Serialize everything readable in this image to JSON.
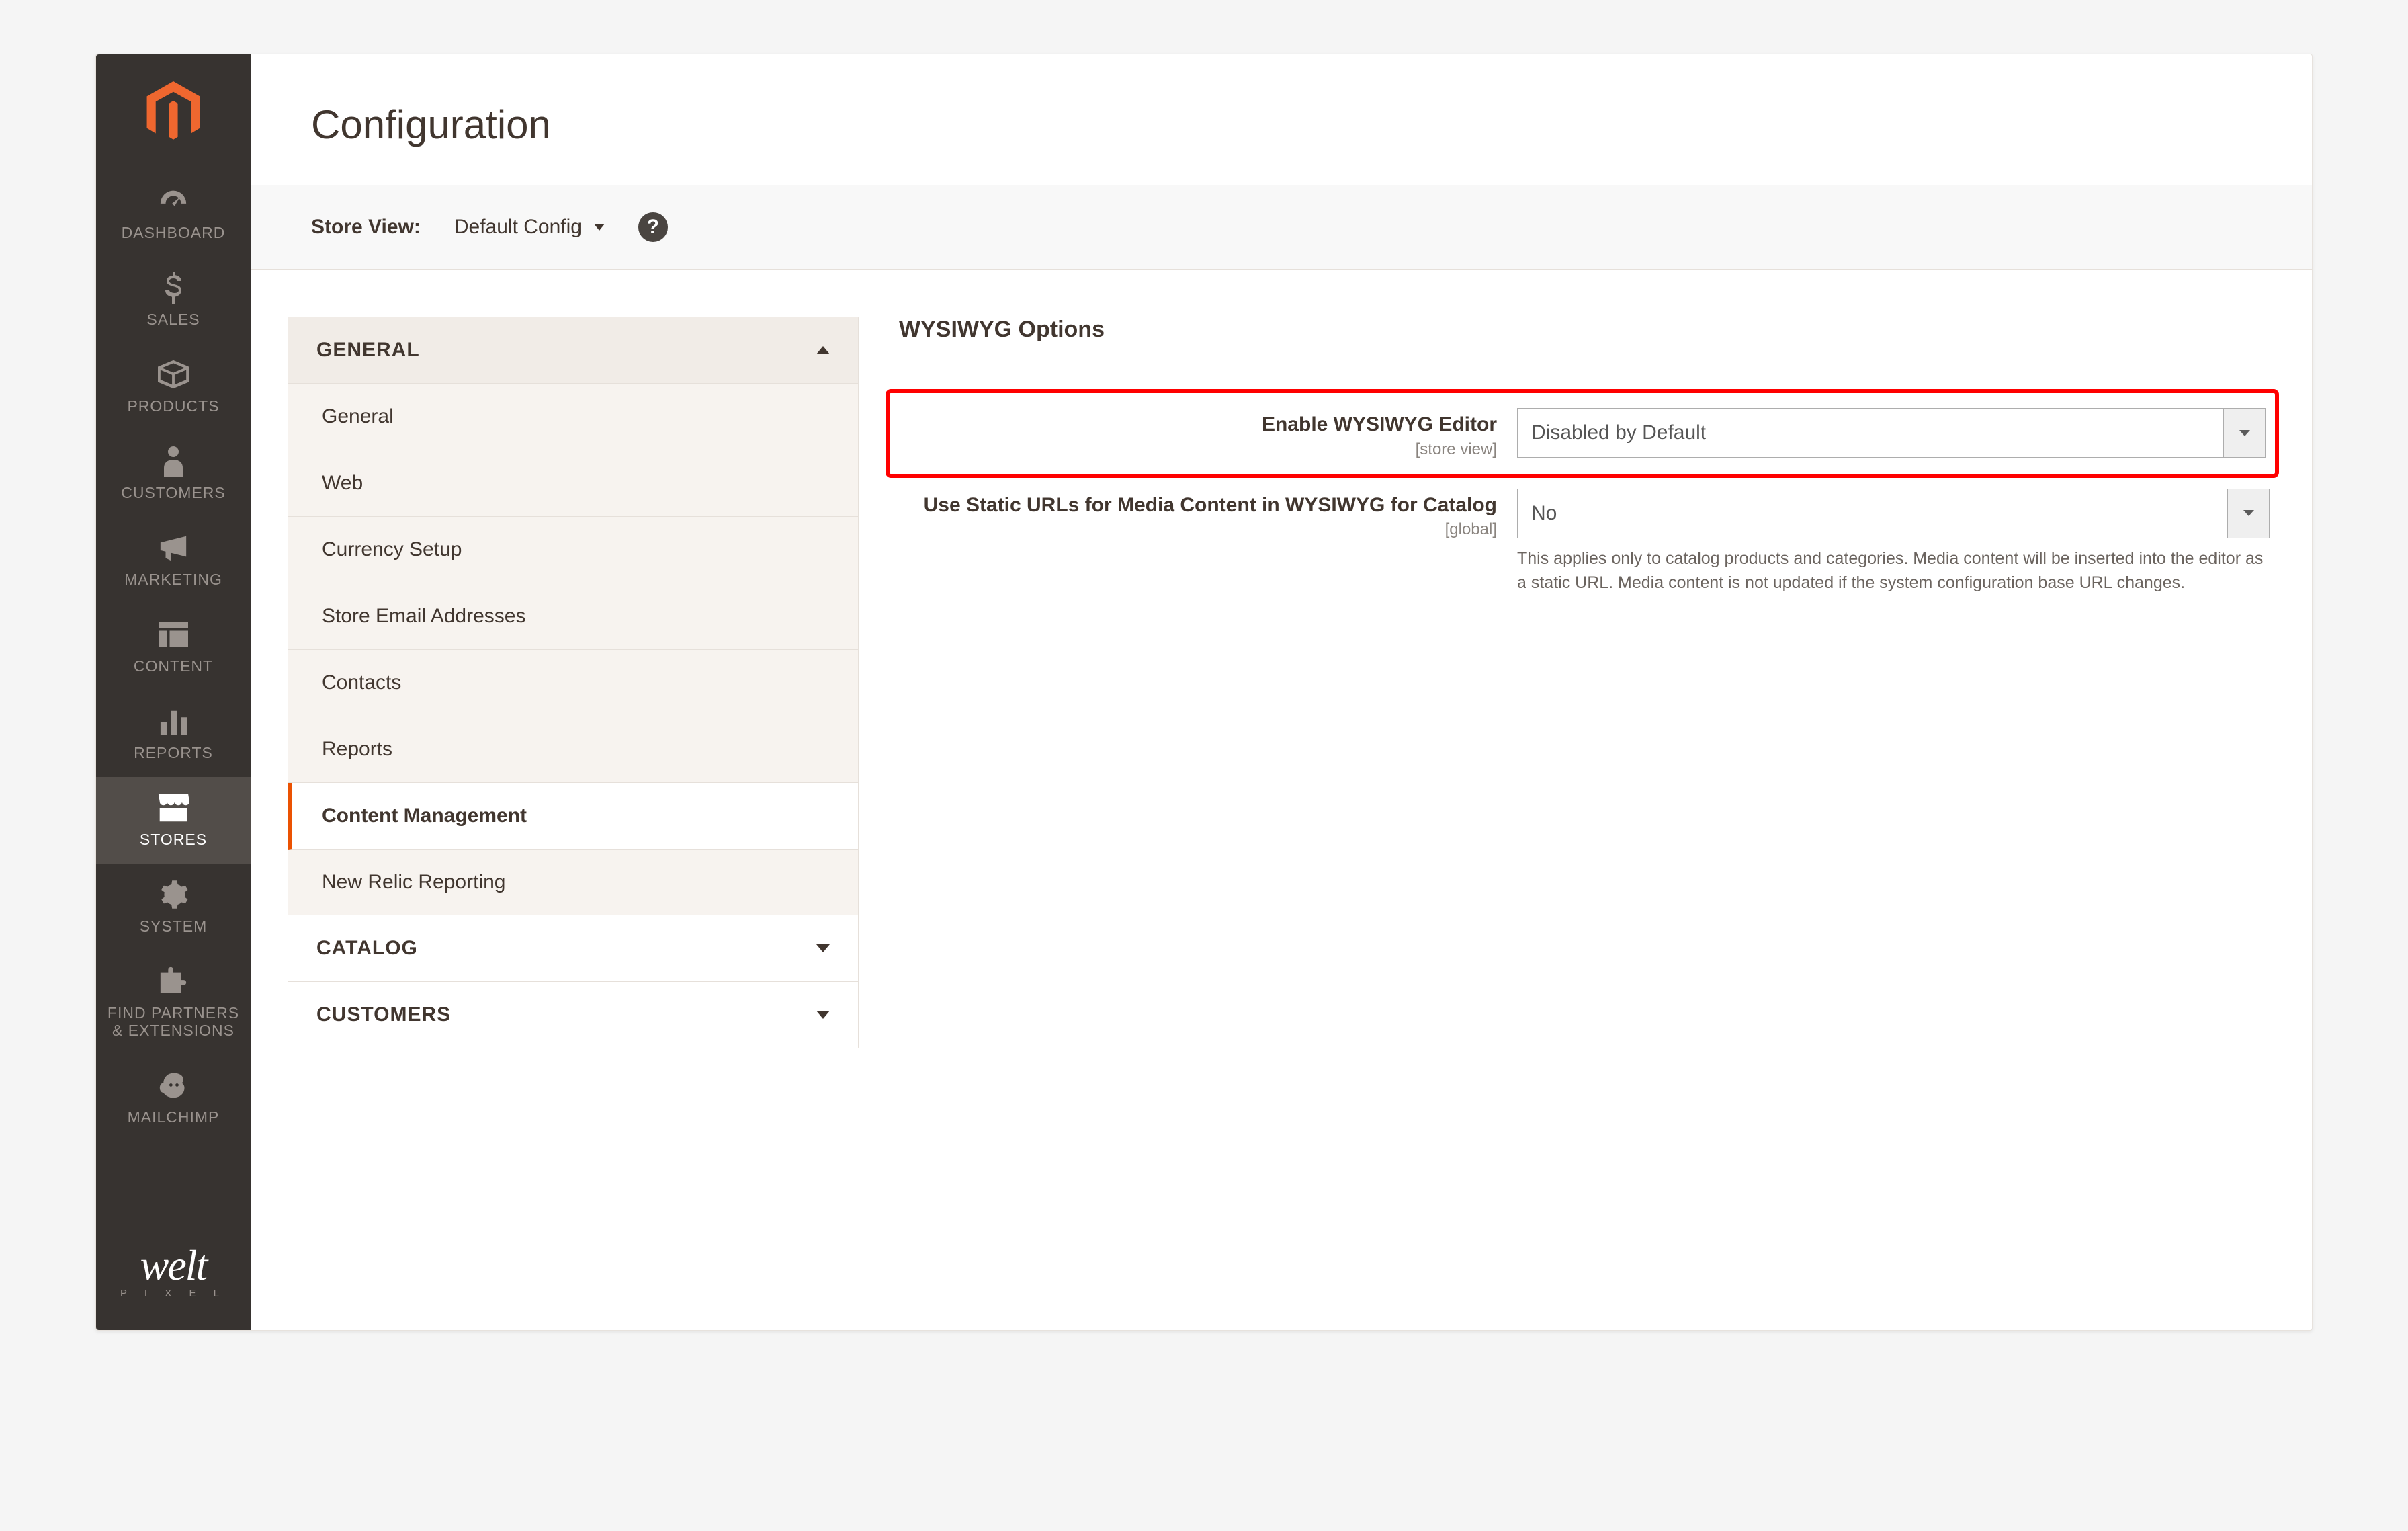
{
  "page": {
    "title": "Configuration"
  },
  "store_view": {
    "label": "Store View:",
    "value": "Default Config"
  },
  "admin_nav": [
    {
      "key": "dashboard",
      "label": "DASHBOARD"
    },
    {
      "key": "sales",
      "label": "SALES"
    },
    {
      "key": "products",
      "label": "PRODUCTS"
    },
    {
      "key": "customers",
      "label": "CUSTOMERS"
    },
    {
      "key": "marketing",
      "label": "MARKETING"
    },
    {
      "key": "content",
      "label": "CONTENT"
    },
    {
      "key": "reports",
      "label": "REPORTS"
    },
    {
      "key": "stores",
      "label": "STORES",
      "active": true
    },
    {
      "key": "system",
      "label": "SYSTEM"
    },
    {
      "key": "partners",
      "label": "FIND PARTNERS & EXTENSIONS"
    },
    {
      "key": "mailchimp",
      "label": "MAILCHIMP"
    }
  ],
  "brand": {
    "name": "welt",
    "tag": "P I X E L"
  },
  "cfg_nav": {
    "groups": [
      {
        "label": "GENERAL",
        "open": true,
        "tabs": [
          {
            "label": "General"
          },
          {
            "label": "Web"
          },
          {
            "label": "Currency Setup"
          },
          {
            "label": "Store Email Addresses"
          },
          {
            "label": "Contacts"
          },
          {
            "label": "Reports"
          },
          {
            "label": "Content Management",
            "active": true
          },
          {
            "label": "New Relic Reporting"
          }
        ]
      },
      {
        "label": "CATALOG",
        "open": false
      },
      {
        "label": "CUSTOMERS",
        "open": false
      }
    ]
  },
  "section": {
    "title": "WYSIWYG Options"
  },
  "fields": {
    "enable_wysiwyg": {
      "label": "Enable WYSIWYG Editor",
      "scope": "[store view]",
      "value": "Disabled by Default"
    },
    "static_urls": {
      "label": "Use Static URLs for Media Content in WYSIWYG for Catalog",
      "scope": "[global]",
      "value": "No",
      "helper": "This applies only to catalog products and categories. Media content will be inserted into the editor as a static URL. Media content is not updated if the system configuration base URL changes."
    }
  }
}
